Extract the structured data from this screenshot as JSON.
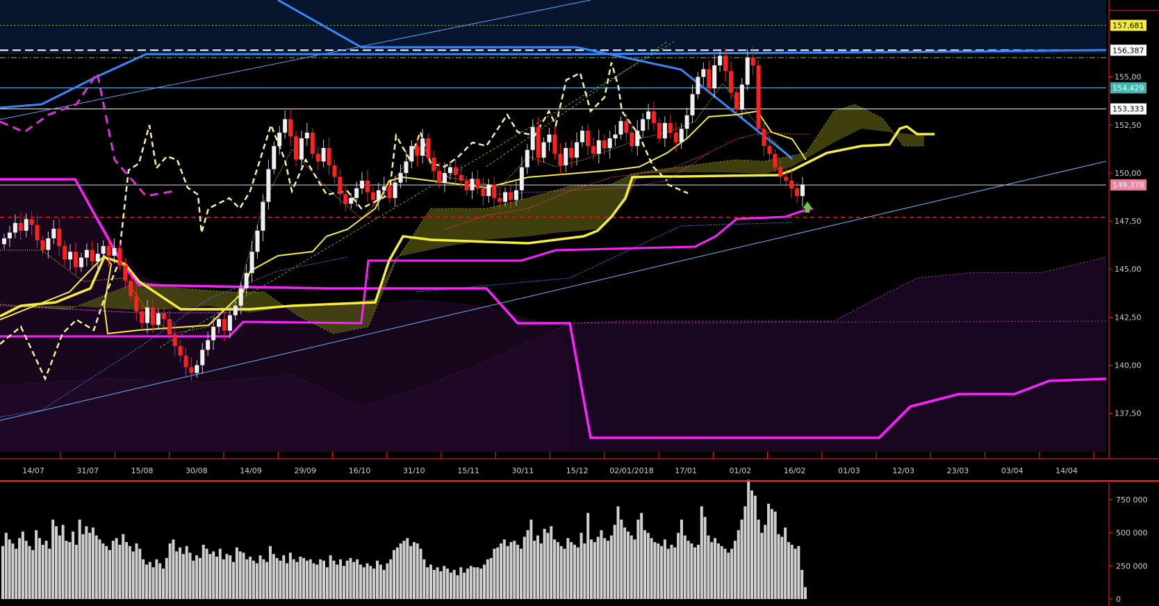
{
  "chart_data": [
    {
      "type": "candlestick",
      "panel": "price",
      "ylim": [
        135.5,
        159.0
      ],
      "y_ticks": [
        "137,50",
        "140,00",
        "142,50",
        "145,00",
        "147,50",
        "150,00",
        "152,50",
        "155,00"
      ],
      "y_tick_values": [
        137.5,
        140.0,
        142.5,
        145.0,
        147.5,
        150.0,
        152.5,
        155.0
      ],
      "x_ticks": [
        "14/07",
        "31/07",
        "15/08",
        "30/08",
        "14/09",
        "29/09",
        "16/10",
        "31/10",
        "15/11",
        "30/11",
        "15/12",
        "02/01/2018",
        "17/01",
        "01/02",
        "16/02",
        "01/03",
        "12/03",
        "23/03",
        "03/04",
        "14/04"
      ],
      "price_tags": [
        {
          "label": "157,681",
          "value": 157.681,
          "bg": "#f6ee3a",
          "fg": "#000000"
        },
        {
          "label": "156,387",
          "value": 156.387,
          "bg": "#ffffff",
          "fg": "#000000"
        },
        {
          "label": "154,429",
          "value": 154.429,
          "bg": "#3fb6b0",
          "fg": "#ffffff"
        },
        {
          "label": "153,333",
          "value": 153.333,
          "bg": "#ffffff",
          "fg": "#000000"
        },
        {
          "label": "149,378",
          "value": 149.378,
          "bg": "#f080a0",
          "fg": "#ffffff"
        }
      ],
      "horizontal_lines": [
        {
          "value": 157.681,
          "color": "#9acd32",
          "style": "dotted"
        },
        {
          "value": 156.387,
          "color": "#ffffff",
          "style": "dashed"
        },
        {
          "value": 156.0,
          "color": "#9acd32",
          "style": "dashdot"
        },
        {
          "value": 154.429,
          "color": "#66ccff",
          "style": "solid"
        },
        {
          "value": 153.333,
          "color": "#ffffff",
          "style": "solid"
        },
        {
          "value": 149.378,
          "color": "#dddddd",
          "style": "solid"
        },
        {
          "value": 147.7,
          "color": "#ff2020",
          "style": "dashed"
        }
      ],
      "series": [
        {
          "role": "close",
          "values": [
            146.6,
            146.9,
            147.4,
            147.0,
            147.6,
            147.3,
            146.5,
            146.0,
            146.6,
            147.1,
            146.2,
            145.5,
            145.9,
            145.1,
            145.6,
            146.0,
            145.4,
            145.8,
            146.2,
            145.7,
            146.1,
            145.2,
            144.4,
            143.6,
            142.8,
            142.2,
            143.0,
            142.1,
            142.7,
            142.4,
            141.6,
            141.0,
            140.5,
            139.9,
            139.6,
            140.0,
            140.8,
            141.3,
            142.0,
            142.4,
            141.8,
            142.6,
            143.1,
            144.0,
            144.8,
            145.9,
            147.0,
            148.5,
            150.2,
            151.4,
            152.1,
            152.8,
            151.9,
            150.7,
            151.8,
            152.1,
            151.0,
            150.6,
            151.3,
            150.4,
            149.8,
            148.9,
            148.4,
            148.7,
            149.2,
            149.6,
            149.0,
            148.6,
            149.1,
            149.3,
            148.7,
            149.5,
            150.0,
            150.6,
            151.4,
            150.9,
            151.8,
            150.8,
            150.1,
            149.5,
            150.0,
            150.3,
            149.9,
            149.6,
            149.1,
            149.7,
            149.2,
            148.8,
            149.4,
            148.7,
            148.5,
            149.0,
            148.6,
            149.1,
            150.3,
            151.2,
            152.4,
            150.8,
            151.6,
            152.0,
            151.0,
            150.4,
            151.3,
            150.8,
            151.6,
            152.2,
            151.4,
            151.0,
            151.7,
            151.3,
            151.8,
            152.0,
            152.7,
            152.1,
            151.4,
            152.2,
            152.8,
            153.2,
            152.6,
            151.8,
            152.6,
            152.1,
            151.6,
            152.3,
            153.0,
            154.1,
            155.0,
            155.4,
            154.4,
            155.6,
            156.1,
            155.3,
            154.2,
            153.3,
            154.6,
            156.0,
            155.6,
            152.3,
            151.4,
            151.0,
            150.3,
            149.8,
            149.6,
            149.2,
            148.8,
            149.4
          ]
        },
        {
          "role": "tenkan",
          "color": "#f6ee3a"
        },
        {
          "role": "kijun",
          "color": "#ff20ff"
        },
        {
          "role": "chikou",
          "color": "#f8f0a0",
          "style": "dashed"
        },
        {
          "role": "senkou_cloud",
          "color": "#cccc33"
        }
      ]
    },
    {
      "type": "bar",
      "panel": "volume",
      "ylim": [
        0,
        850000
      ],
      "y_ticks": [
        "0",
        "250 000",
        "500 000",
        "750 000"
      ],
      "y_tick_values": [
        0,
        250000,
        500000,
        750000
      ],
      "values": [
        400000,
        500000,
        450000,
        420000,
        380000,
        460000,
        510000,
        440000,
        400000,
        370000,
        520000,
        460000,
        410000,
        440000,
        380000,
        600000,
        550000,
        480000,
        560000,
        440000,
        430000,
        510000,
        410000,
        600000,
        490000,
        550000,
        500000,
        540000,
        480000,
        450000,
        420000,
        400000,
        370000,
        440000,
        460000,
        410000,
        490000,
        430000,
        400000,
        360000,
        420000,
        380000,
        300000,
        260000,
        280000,
        240000,
        300000,
        270000,
        230000,
        310000,
        420000,
        450000,
        360000,
        390000,
        340000,
        400000,
        350000,
        290000,
        330000,
        310000,
        410000,
        380000,
        340000,
        360000,
        320000,
        380000,
        300000,
        340000,
        330000,
        280000,
        390000,
        360000,
        350000,
        300000,
        320000,
        290000,
        270000,
        330000,
        300000,
        280000,
        400000,
        340000,
        310000,
        290000,
        330000,
        270000,
        350000,
        300000,
        280000,
        320000,
        310000,
        290000,
        300000,
        270000,
        260000,
        300000,
        290000,
        240000,
        330000,
        290000,
        260000,
        300000,
        250000,
        290000,
        310000,
        280000,
        300000,
        260000,
        240000,
        270000,
        250000,
        230000,
        290000,
        260000,
        220000,
        270000,
        300000,
        370000,
        390000,
        420000,
        440000,
        460000,
        400000,
        430000,
        420000,
        380000,
        300000,
        240000,
        260000,
        220000,
        240000,
        210000,
        250000,
        230000,
        200000,
        220000,
        180000,
        240000,
        200000,
        230000,
        250000,
        240000,
        240000,
        230000,
        260000,
        300000,
        310000,
        380000,
        390000,
        420000,
        450000,
        400000,
        430000,
        440000,
        410000,
        380000,
        470000,
        520000,
        600000,
        440000,
        480000,
        420000,
        530000,
        500000,
        550000,
        450000,
        430000,
        400000,
        380000,
        460000,
        430000,
        410000,
        390000,
        500000,
        420000,
        650000,
        450000,
        430000,
        470000,
        520000,
        460000,
        440000,
        480000,
        560000,
        700000,
        600000,
        540000,
        510000,
        480000,
        450000,
        600000,
        650000,
        520000,
        500000,
        460000,
        430000,
        420000,
        400000,
        450000,
        380000,
        410000,
        390000,
        500000,
        600000,
        480000,
        440000,
        420000,
        390000,
        410000,
        700000,
        620000,
        480000,
        430000,
        460000,
        420000,
        400000,
        380000,
        350000,
        380000,
        440000,
        520000,
        600000,
        700000,
        900000,
        820000,
        780000,
        600000,
        500000,
        560000,
        720000,
        680000,
        660000,
        490000,
        470000,
        540000,
        430000,
        410000,
        380000,
        400000,
        220000,
        90000
      ]
    }
  ]
}
